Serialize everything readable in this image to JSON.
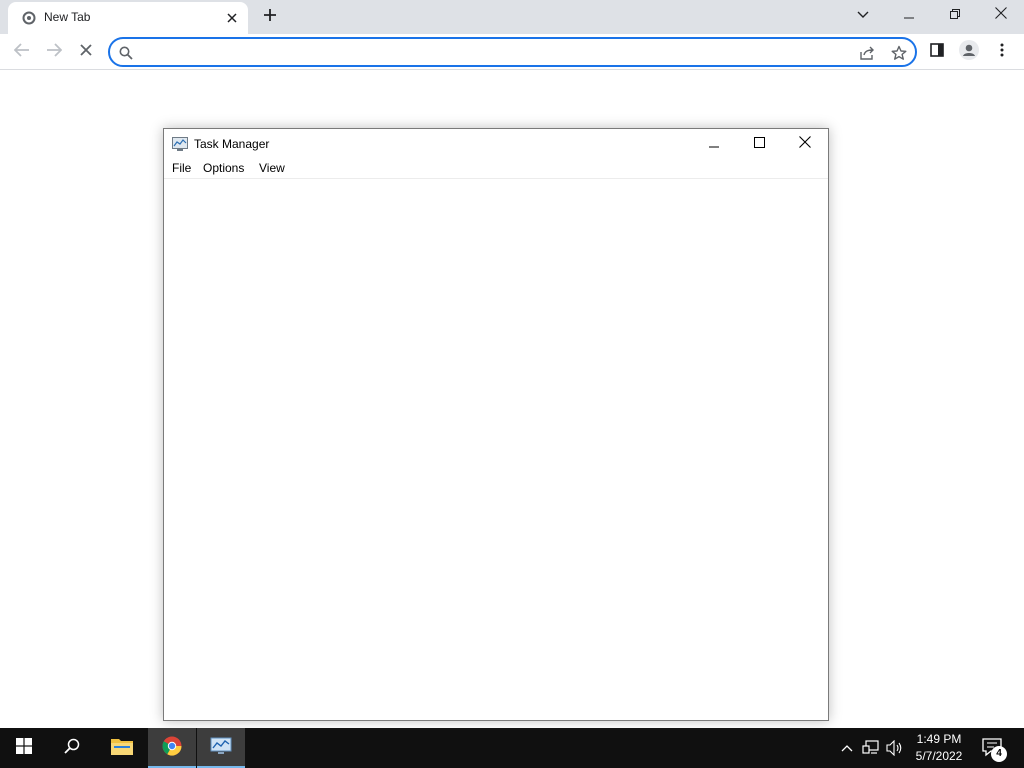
{
  "browser": {
    "tab": {
      "title": "New Tab",
      "favicon": "chrome-newtab-icon",
      "close_icon": "close-icon"
    },
    "new_tab_icon": "plus-icon",
    "window_controls": [
      "chevron-down-icon",
      "minimize-icon",
      "restore-icon",
      "close-icon"
    ],
    "omnibox": {
      "value": "",
      "placeholder": ""
    },
    "toolbar_icons": [
      "back-icon",
      "forward-icon",
      "stop-icon",
      "share-icon",
      "star-icon",
      "side-panel-icon",
      "profile-icon",
      "more-icon"
    ]
  },
  "task_manager": {
    "title": "Task Manager",
    "menu": {
      "file": "File",
      "options": "Options",
      "view": "View"
    },
    "controls": [
      "minimize-icon",
      "maximize-icon",
      "close-icon"
    ]
  },
  "taskbar": {
    "items": [
      "windows-start-icon",
      "search-icon",
      "file-explorer-icon",
      "chrome-icon",
      "task-manager-icon"
    ],
    "tray_icons": [
      "chevron-up-icon",
      "network-icon",
      "volume-icon"
    ],
    "clock": {
      "time": "1:49 PM",
      "date": "5/7/2022"
    },
    "notifications": {
      "count": "4"
    }
  },
  "colors": {
    "accent": "#1a73e8",
    "tabstrip": "#dee1e6",
    "taskbar": "#101010",
    "active_indicator": "#76b9ed"
  }
}
